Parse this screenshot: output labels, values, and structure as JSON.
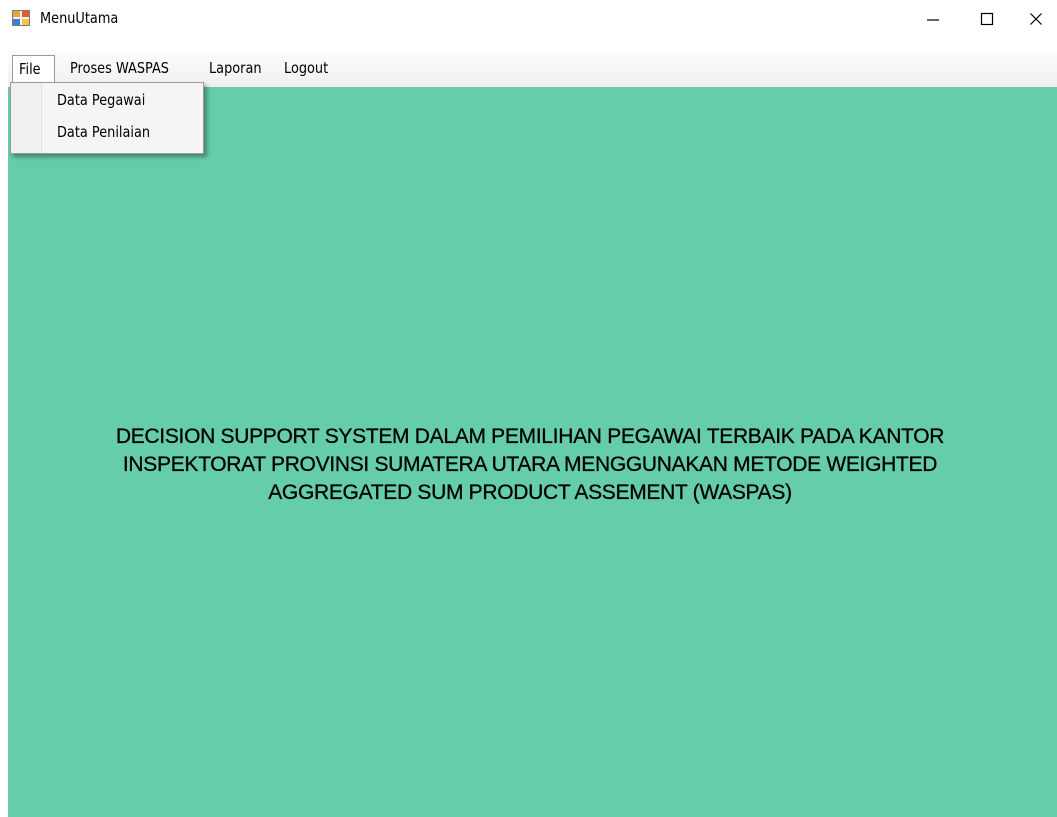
{
  "window": {
    "title": "MenuUtama"
  },
  "menubar": {
    "items": [
      {
        "label": "File"
      },
      {
        "label": "Proses WASPAS"
      },
      {
        "label": "Laporan"
      },
      {
        "label": "Logout"
      }
    ]
  },
  "file_menu": {
    "items": [
      {
        "label": "Data Pegawai"
      },
      {
        "label": "Data Penilaian"
      }
    ]
  },
  "main": {
    "title": "DECISION SUPPORT SYSTEM DALAM PEMILIHAN PEGAWAI TERBAIK PADA KANTOR\nINSPEKTORAT PROVINSI SUMATERA UTARA MENGGUNAKAN METODE WEIGHTED\nAGGREGATED SUM PRODUCT ASSEMENT (WASPAS)",
    "background_color": "#66cdaa"
  },
  "icons": {
    "app": "winforms-app-icon",
    "minimize": "minimize-icon",
    "maximize": "maximize-icon",
    "close": "close-icon"
  }
}
